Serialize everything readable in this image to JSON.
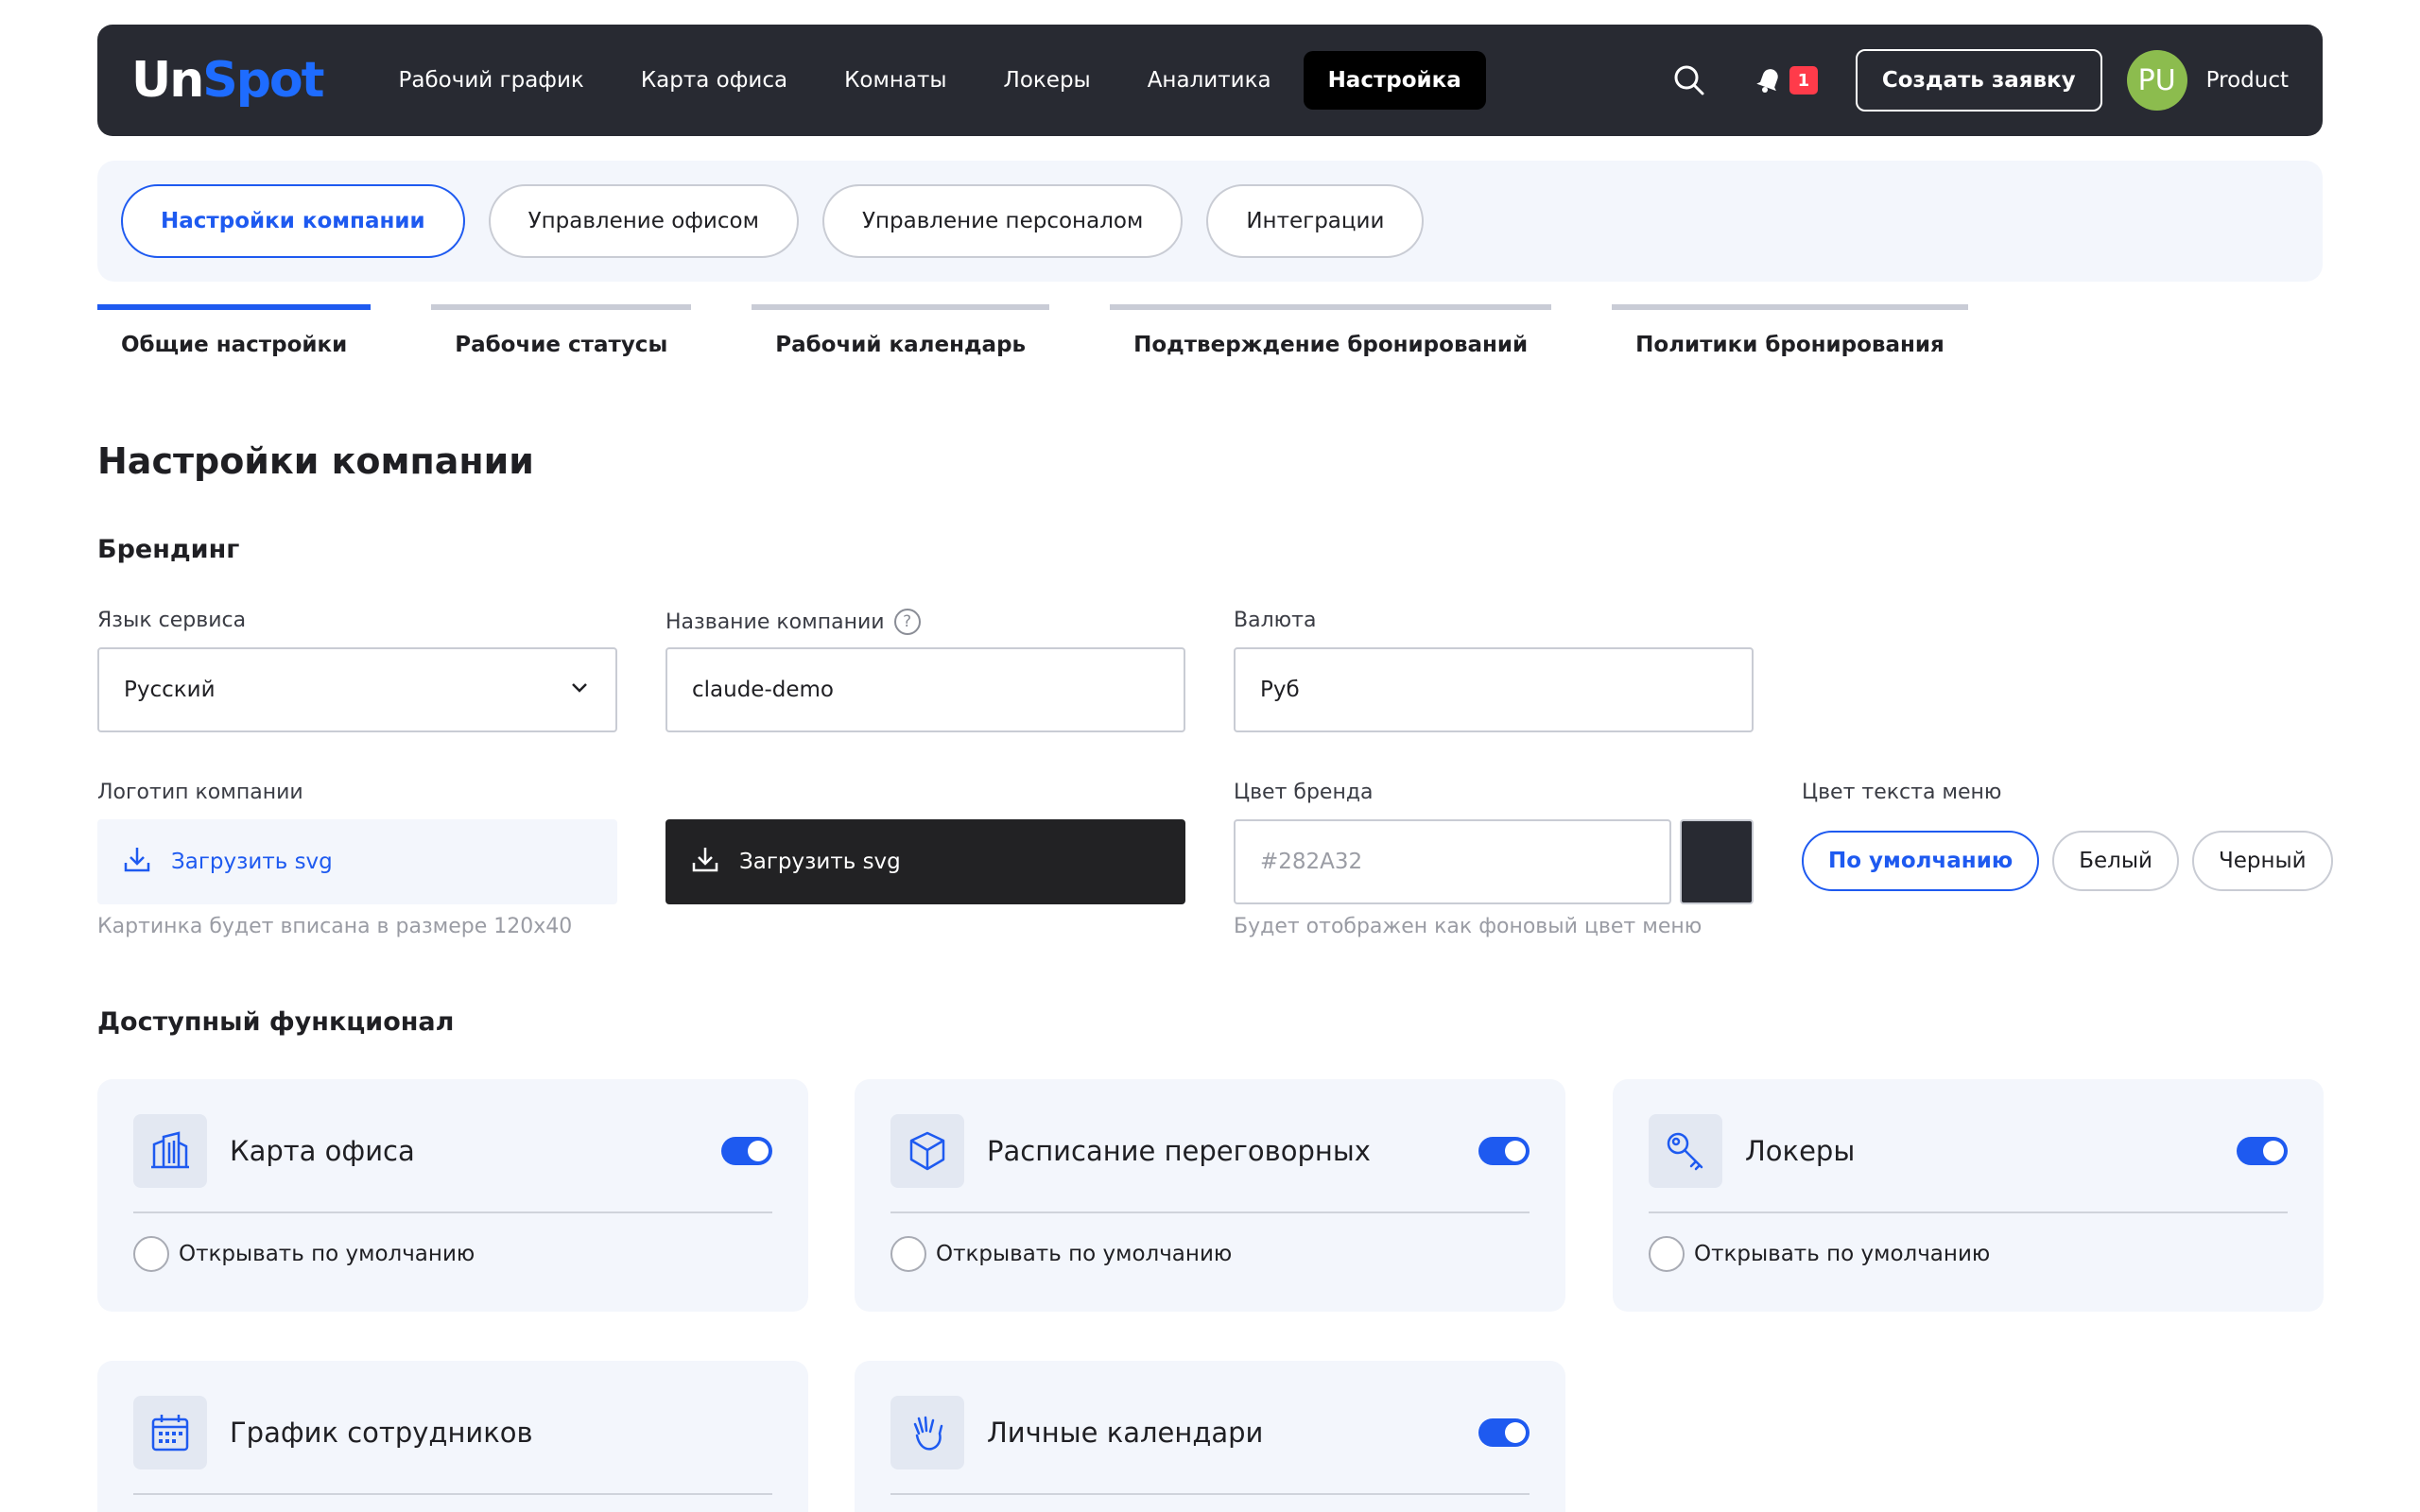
{
  "header": {
    "logo_un": "Un",
    "logo_spot": "Spot",
    "nav": [
      "Рабочий график",
      "Карта офиса",
      "Комнаты",
      "Локеры",
      "Аналитика",
      "Настройка"
    ],
    "active_nav": "Настройка",
    "notification_count": "1",
    "create_button": "Создать заявку",
    "avatar_initials": "PU",
    "user_name": "Product"
  },
  "section_tabs": [
    "Настройки компании",
    "Управление офисом",
    "Управление персоналом",
    "Интеграции"
  ],
  "sub_tabs": [
    "Общие настройки",
    "Рабочие статусы",
    "Рабочий календарь",
    "Подтверждение бронирований",
    "Политики бронирования"
  ],
  "page_title": "Настройки компании",
  "branding": {
    "title": "Брендинг",
    "language_label": "Язык сервиса",
    "language_value": "Русский",
    "company_label": "Название компании",
    "company_value": "claude-demo",
    "currency_label": "Валюта",
    "currency_value": "Руб",
    "logo_label": "Логотип компании",
    "upload_light": "Загрузить svg",
    "upload_dark": "Загрузить svg",
    "logo_hint": "Картинка будет вписана в размере 120х40",
    "brand_color_label": "Цвет бренда",
    "brand_color_placeholder": "#282A32",
    "brand_color_hint": "Будет отображен как фоновый цвет меню",
    "menu_text_color_label": "Цвет текста меню",
    "menu_text_options": [
      "По умолчанию",
      "Белый",
      "Черный"
    ]
  },
  "features": {
    "title": "Доступный функционал",
    "cards": [
      {
        "title": "Карта офиса",
        "icon": "building-icon",
        "option": "Открывать по умолчанию",
        "enabled": true
      },
      {
        "title": "Расписание переговорных",
        "icon": "cube-icon",
        "option": "Открывать по умолчанию",
        "enabled": true
      },
      {
        "title": "Локеры",
        "icon": "key-icon",
        "option": "Открывать по умолчанию",
        "enabled": true
      },
      {
        "title": "График сотрудников",
        "icon": "calendar-icon",
        "option": "",
        "enabled": false
      },
      {
        "title": "Личные календари",
        "icon": "hand-icon",
        "option": "",
        "enabled": true
      }
    ]
  },
  "colors": {
    "header_bg": "#282a32",
    "accent": "#1e5af0",
    "card_bg": "#f3f6fc",
    "badge": "#ff3b4a",
    "avatar": "#8cbc4e"
  }
}
